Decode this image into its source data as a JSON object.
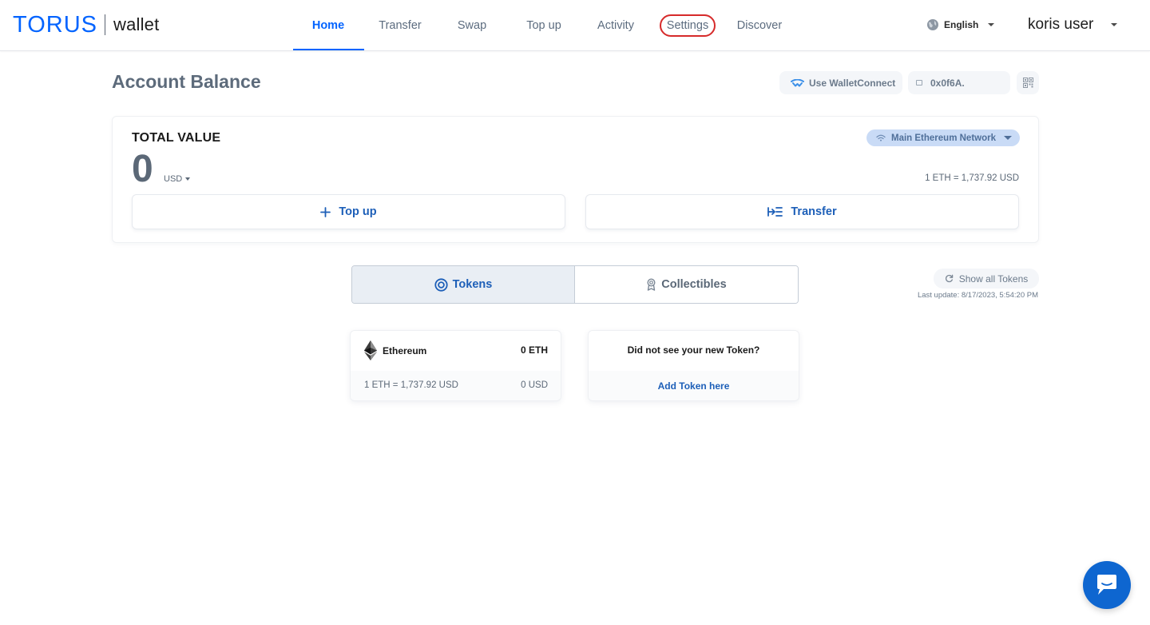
{
  "app": {
    "logo_brand": "TORUS",
    "logo_product": "wallet"
  },
  "nav": {
    "items": [
      {
        "label": "Home",
        "active": true
      },
      {
        "label": "Transfer",
        "active": false
      },
      {
        "label": "Swap",
        "active": false
      },
      {
        "label": "Top up",
        "active": false
      },
      {
        "label": "Activity",
        "active": false
      },
      {
        "label": "Settings",
        "active": false,
        "highlighted": true
      },
      {
        "label": "Discover",
        "active": false
      }
    ]
  },
  "header": {
    "language": "English",
    "user_name": "koris user"
  },
  "account": {
    "title": "Account Balance",
    "walletconnect_label": "Use WalletConnect",
    "address_short": "0x0f6A."
  },
  "balance_card": {
    "label": "TOTAL VALUE",
    "amount": "0",
    "currency": "USD",
    "network": "Main Ethereum Network",
    "rate": "1 ETH = 1,737.92 USD",
    "topup_label": "Top up",
    "transfer_label": "Transfer"
  },
  "tabs": {
    "tokens_label": "Tokens",
    "collectibles_label": "Collectibles",
    "active": "tokens"
  },
  "tokens_toolbar": {
    "show_all_label": "Show all Tokens",
    "last_update": "Last update: 8/17/2023, 5:54:20 PM"
  },
  "tokens": [
    {
      "name": "Ethereum",
      "balance": "0 ETH",
      "rate": "1 ETH = 1,737.92 USD",
      "value_usd": "0 USD"
    }
  ],
  "add_token": {
    "question": "Did not see your new Token?",
    "link_label": "Add Token here"
  },
  "colors": {
    "accent": "#0364ff",
    "link": "#1d5fb8",
    "muted": "#5b6877",
    "settings_highlight": "#d62a2a",
    "chat_button": "#0e66d0"
  },
  "icons": {
    "globe": "globe-icon",
    "walletconnect": "walletconnect-icon",
    "qr": "qr-code-icon",
    "wifi": "network-signal-icon",
    "plus": "plus-icon",
    "transfer": "transfer-icon",
    "tokens": "token-coin-icon",
    "collectibles": "collectibles-icon",
    "refresh": "refresh-icon",
    "ethereum": "ethereum-icon",
    "chat": "chat-icon"
  }
}
